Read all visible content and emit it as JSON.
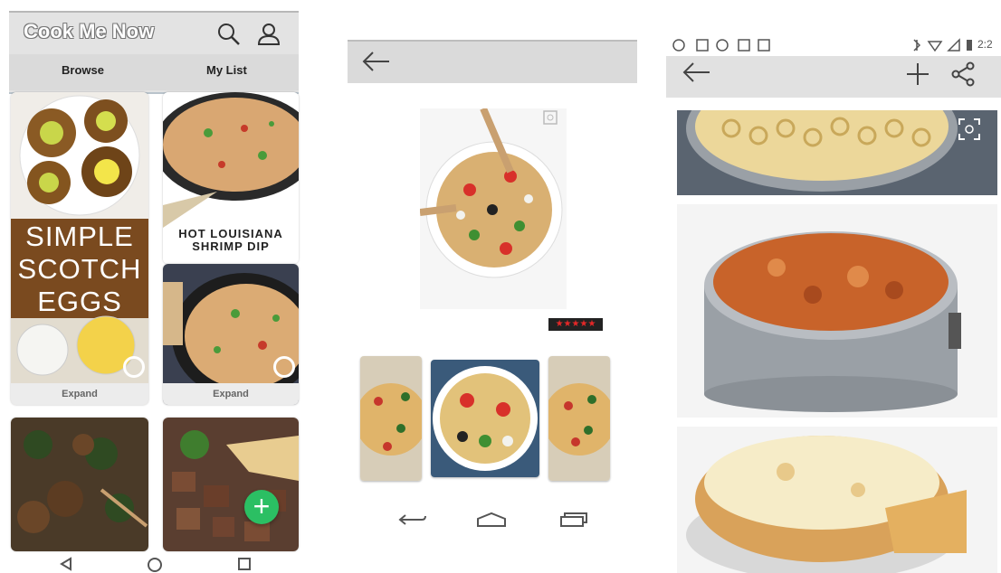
{
  "screen1": {
    "app_title": "Cook Me Now",
    "tabs": [
      {
        "label": "Browse"
      },
      {
        "label": "My List"
      }
    ],
    "cards": [
      {
        "title_lines": [
          "SIMPLE",
          "SCOTCH",
          "EGGS"
        ],
        "expand_label": "Expand"
      },
      {
        "title_lines": [
          "HOT LOUISIANA",
          "SHRIMP DIP"
        ]
      },
      {
        "expand_label": "Expand"
      }
    ],
    "fab_label": "+",
    "icons": [
      "search-icon",
      "account-icon",
      "back-nav-icon",
      "home-nav-icon",
      "recents-nav-icon",
      "plus-icon"
    ]
  },
  "screen2": {
    "rating_stars": "★★★★★",
    "icons": [
      "back-arrow-icon",
      "expand-image-icon",
      "back-nav-icon",
      "home-nav-icon",
      "recents-nav-icon"
    ]
  },
  "screen3": {
    "status_time": "2:2",
    "icons": [
      "back-arrow-icon",
      "add-icon",
      "share-icon",
      "expand-image-icon"
    ]
  }
}
